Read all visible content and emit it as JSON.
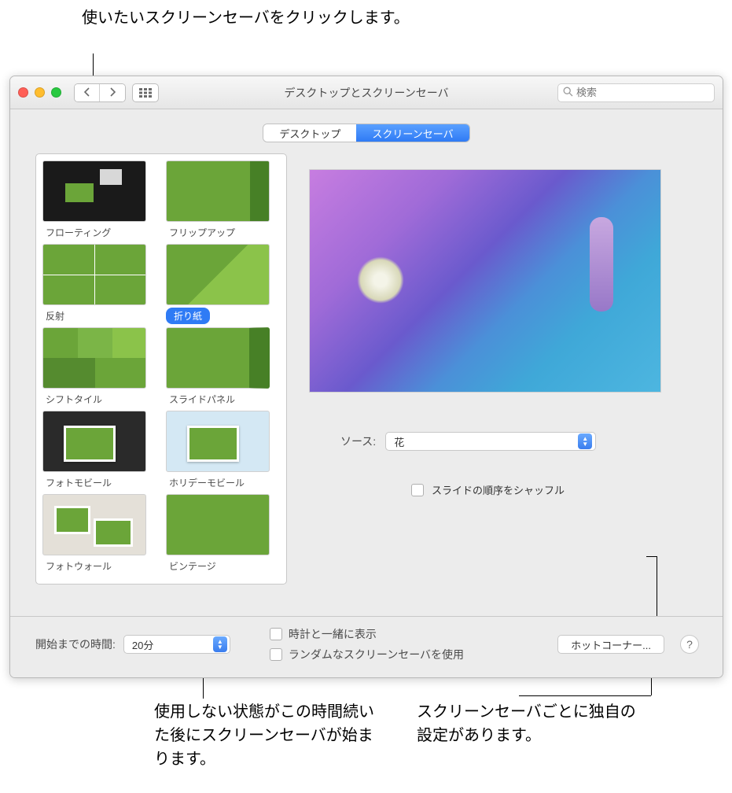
{
  "callouts": {
    "top": "使いたいスクリーンセーバをクリックします。",
    "bottom_left": "使用しない状態がこの時間続いた後にスクリーンセーバが始まります。",
    "bottom_right": "スクリーンセーバごとに独自の設定があります。"
  },
  "window": {
    "title": "デスクトップとスクリーンセーバ",
    "search_placeholder": "検索"
  },
  "tabs": {
    "desktop": "デスクトップ",
    "screensaver": "スクリーンセーバ"
  },
  "savers": [
    {
      "label": "フローティング"
    },
    {
      "label": "フリップアップ"
    },
    {
      "label": "反射"
    },
    {
      "label": "折り紙",
      "selected": true
    },
    {
      "label": "シフトタイル"
    },
    {
      "label": "スライドパネル"
    },
    {
      "label": "フォトモビール"
    },
    {
      "label": "ホリデーモビール"
    },
    {
      "label": "フォトウォール"
    },
    {
      "label": "ビンテージ"
    }
  ],
  "source": {
    "label": "ソース:",
    "value": "花"
  },
  "shuffle": {
    "label": "スライドの順序をシャッフル"
  },
  "footer": {
    "time_label": "開始までの時間:",
    "time_value": "20分",
    "show_clock": "時計と一緒に表示",
    "random": "ランダムなスクリーンセーバを使用",
    "hot_corners": "ホットコーナー..."
  }
}
